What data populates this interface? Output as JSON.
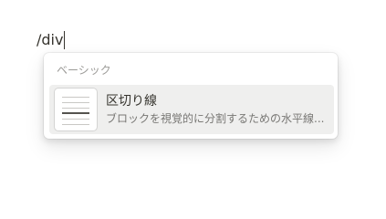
{
  "editor": {
    "text": "/div"
  },
  "menu": {
    "section_label": "ベーシック",
    "items": [
      {
        "title": "区切り線",
        "description": "ブロックを視覚的に分割するための水平線...",
        "icon": "divider-preview-icon"
      }
    ]
  },
  "colors": {
    "text": "#37352f",
    "muted": "#9b9a97",
    "highlight": "#efefee"
  }
}
